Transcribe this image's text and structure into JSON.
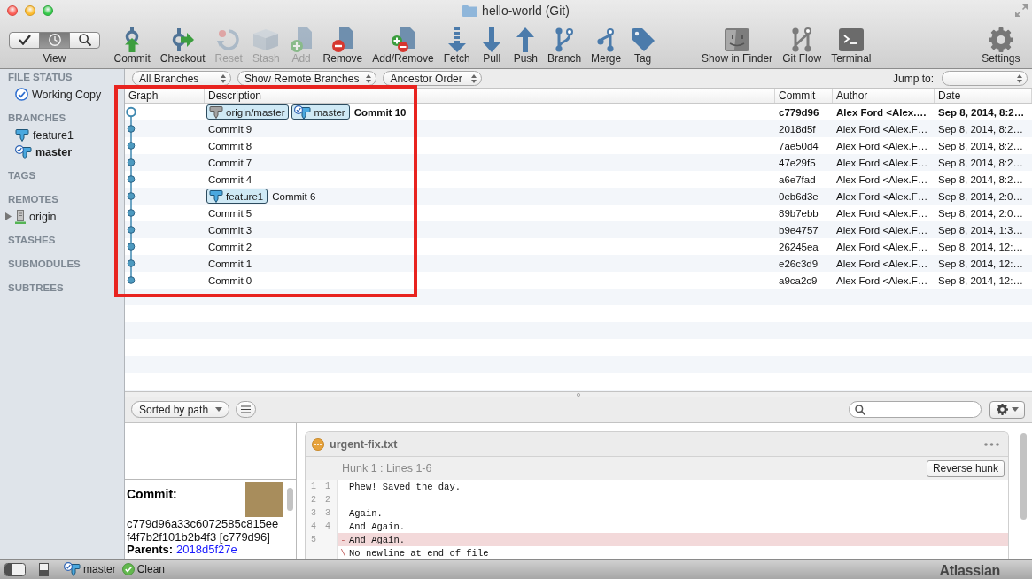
{
  "window": {
    "title": "hello-world (Git)"
  },
  "toolbar": {
    "view": {
      "label": "View",
      "modes": [
        {
          "selected": false
        },
        {
          "selected": true
        },
        {
          "selected": false
        }
      ]
    },
    "actions": [
      {
        "label": "Commit",
        "disabled": false
      },
      {
        "label": "Checkout",
        "disabled": false
      },
      {
        "label": "Reset",
        "disabled": true
      },
      {
        "label": "Stash",
        "disabled": true
      },
      {
        "label": "Add",
        "disabled": true
      },
      {
        "label": "Remove",
        "disabled": false
      },
      {
        "label": "Add/Remove",
        "disabled": false
      },
      {
        "label": "Fetch",
        "disabled": false
      },
      {
        "label": "Pull",
        "disabled": false
      },
      {
        "label": "Push",
        "disabled": false
      },
      {
        "label": "Branch",
        "disabled": false
      },
      {
        "label": "Merge",
        "disabled": false
      },
      {
        "label": "Tag",
        "disabled": false
      }
    ],
    "tools": [
      {
        "label": "Show in Finder"
      },
      {
        "label": "Git Flow"
      },
      {
        "label": "Terminal"
      }
    ],
    "settings": {
      "label": "Settings"
    }
  },
  "sidebar": {
    "sections": [
      {
        "title": "FILE STATUS",
        "items": [
          {
            "kind": "status",
            "label": "Working Copy"
          }
        ]
      },
      {
        "title": "BRANCHES",
        "items": [
          {
            "kind": "branch",
            "label": "feature1",
            "current": false
          },
          {
            "kind": "branch",
            "label": "master",
            "current": true
          }
        ]
      },
      {
        "title": "TAGS"
      },
      {
        "title": "REMOTES",
        "items": [
          {
            "kind": "remote",
            "label": "origin",
            "expanded": false
          }
        ]
      },
      {
        "title": "STASHES"
      },
      {
        "title": "SUBMODULES"
      },
      {
        "title": "SUBTREES"
      }
    ]
  },
  "filters": {
    "dropdowns": [
      {
        "label": "All Branches"
      },
      {
        "label": "Show Remote Branches"
      },
      {
        "label": "Ancestor Order"
      }
    ],
    "jump_to": {
      "label": "Jump to:"
    }
  },
  "table": {
    "columns": [
      "Graph",
      "Description",
      "Commit",
      "Author",
      "Date"
    ],
    "rows": [
      {
        "head": true,
        "refs": [
          {
            "kind": "remote",
            "name": "origin/master"
          },
          {
            "kind": "current",
            "name": "master"
          }
        ],
        "description": "Commit 10",
        "commit": "c779d96",
        "author": "Alex Ford <Alex.…",
        "date": "Sep 8, 2014, 8:2…"
      },
      {
        "head": false,
        "description": "Commit 9",
        "commit": "2018d5f",
        "author": "Alex Ford <Alex.F…",
        "date": "Sep 8, 2014, 8:2…"
      },
      {
        "head": false,
        "description": "Commit 8",
        "commit": "7ae50d4",
        "author": "Alex Ford <Alex.F…",
        "date": "Sep 8, 2014, 8:2…"
      },
      {
        "head": false,
        "description": "Commit 7",
        "commit": "47e29f5",
        "author": "Alex Ford <Alex.F…",
        "date": "Sep 8, 2014, 8:2…"
      },
      {
        "head": false,
        "description": "Commit 4",
        "commit": "a6e7fad",
        "author": "Alex Ford <Alex.F…",
        "date": "Sep 8, 2014, 8:2…"
      },
      {
        "head": false,
        "refs": [
          {
            "kind": "local",
            "name": "feature1"
          }
        ],
        "description": "Commit 6",
        "commit": "0eb6d3e",
        "author": "Alex Ford <Alex.F…",
        "date": "Sep 8, 2014, 2:0…"
      },
      {
        "head": false,
        "description": "Commit 5",
        "commit": "89b7ebb",
        "author": "Alex Ford <Alex.F…",
        "date": "Sep 8, 2014, 2:0…"
      },
      {
        "head": false,
        "description": "Commit 3",
        "commit": "b9e4757",
        "author": "Alex Ford <Alex.F…",
        "date": "Sep 8, 2014, 1:3…"
      },
      {
        "head": false,
        "description": "Commit 2",
        "commit": "26245ea",
        "author": "Alex Ford <Alex.F…",
        "date": "Sep 8, 2014, 12:…"
      },
      {
        "head": false,
        "description": "Commit 1",
        "commit": "e26c3d9",
        "author": "Alex Ford <Alex.F…",
        "date": "Sep 8, 2014, 12:…"
      },
      {
        "head": false,
        "description": "Commit 0",
        "commit": "a9ca2c9",
        "author": "Alex Ford <Alex.F…",
        "date": "Sep 8, 2014, 12:…"
      }
    ]
  },
  "file_toolbar": {
    "sort": {
      "label": "Sorted by path"
    }
  },
  "commit_info": {
    "label": "Commit:",
    "hash": "c779d96a33c6072585c815eef4f7b2f101b2b4f3 [c779d96]",
    "parents_label": "Parents:",
    "parent": "2018d5f27e"
  },
  "diff": {
    "file": "urgent-fix.txt",
    "hunk": {
      "title": "Hunk 1 : Lines 1-6",
      "button": "Reverse hunk"
    },
    "lines": [
      {
        "kind": "context",
        "old": "1",
        "new": "1",
        "text": "Phew! Saved the day."
      },
      {
        "kind": "context",
        "old": "2",
        "new": "2"
      },
      {
        "kind": "context",
        "old": "3",
        "new": "3",
        "text": "Again."
      },
      {
        "kind": "context",
        "old": "4",
        "new": "4",
        "text": "And Again."
      },
      {
        "kind": "removed",
        "old": "5",
        "marker": "-",
        "text": "And Again."
      },
      {
        "kind": "note",
        "marker": "\\",
        "text": "No newline at end of file"
      }
    ]
  },
  "status_bar": {
    "branch": "master",
    "state": "Clean",
    "logo": "Atlassian"
  },
  "annotation": {
    "kind": "frame"
  }
}
